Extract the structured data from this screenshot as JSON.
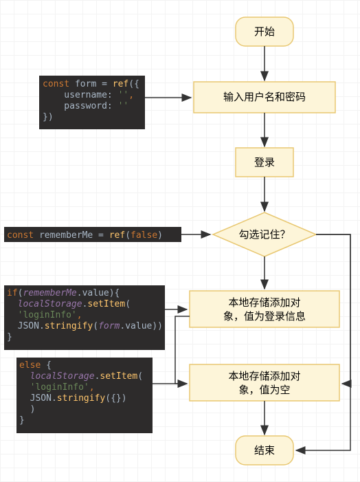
{
  "chart_data": {
    "type": "flowchart",
    "nodes": [
      {
        "id": "start",
        "shape": "rounded",
        "text": "开始"
      },
      {
        "id": "input",
        "shape": "rect",
        "text": "输入用户名和密码"
      },
      {
        "id": "login",
        "shape": "rect",
        "text": "登录"
      },
      {
        "id": "decide",
        "shape": "diamond",
        "text": "勾选记住？"
      },
      {
        "id": "store1",
        "shape": "rect",
        "text": "本地存储添加对象，值为登录信息"
      },
      {
        "id": "store2",
        "shape": "rect",
        "text": "本地存储添加对象，值为空"
      },
      {
        "id": "end",
        "shape": "rounded",
        "text": "结束"
      }
    ],
    "edges": [
      {
        "from": "start",
        "to": "input"
      },
      {
        "from": "input",
        "to": "login"
      },
      {
        "from": "login",
        "to": "decide"
      },
      {
        "from": "decide",
        "to": "store1"
      },
      {
        "from": "store1",
        "to": "store2"
      },
      {
        "from": "store2",
        "to": "end"
      },
      {
        "from": "decide",
        "to": "store2",
        "via": "right"
      },
      {
        "from": "decide",
        "to": "end",
        "via": "right"
      }
    ],
    "annotations": [
      {
        "near": "input",
        "lang": "js",
        "code": "const form = ref({\n    username: '',\n    password: ''\n})"
      },
      {
        "near": "decide",
        "lang": "js",
        "code": "const rememberMe = ref(false)"
      },
      {
        "near": "store1",
        "lang": "js",
        "code": "if(rememberMe.value){\n  localStorage.setItem(\n  'loginInfo',\n  JSON.stringify(form.value))\n}"
      },
      {
        "near": "store2",
        "lang": "js",
        "code": "else {\n  localStorage.setItem(\n  'loginInfo',\n  JSON.stringify({})\n  )\n}"
      }
    ]
  },
  "n": {
    "start": "开始",
    "input": "输入用户名和密码",
    "login": "登录",
    "decide": "勾选记住？",
    "store1a": "本地存储添加对",
    "store1b": "象，值为登录信息",
    "store2a": "本地存储添加对",
    "store2b": "象，值为空",
    "end": "结束"
  },
  "c1": {
    "l1a": "const ",
    "l1b": "form = ",
    "l1c": "ref",
    "l1d": "({",
    "l2a": "    username: ",
    "l2b": "''",
    "l2c": ",",
    "l3a": "    password: ",
    "l3b": "''",
    "l4": "})"
  },
  "c2": {
    "a": "const ",
    "b": "rememberMe = ",
    "c": "ref",
    "d": "(",
    "e": "false",
    "f": ")"
  },
  "c3": {
    "l1a": "if",
    "l1b": "(",
    "l1c": "rememberMe",
    "l1d": ".value){",
    "l2a": "  localStorage",
    "l2b": ".",
    "l2c": "setItem",
    "l2d": "(",
    "l3a": "  'loginInfo'",
    "l3b": ",",
    "l4a": "  JSON.",
    "l4b": "stringify",
    "l4c": "(",
    "l4d": "form",
    "l4e": ".value))",
    "l5": "}"
  },
  "c4": {
    "l1a": "else ",
    "l1b": "{",
    "l2a": "  localStorage",
    "l2b": ".",
    "l2c": "setItem",
    "l2d": "(",
    "l3a": "  'loginInfo'",
    "l3b": ",",
    "l4a": "  JSON.",
    "l4b": "stringify",
    "l4c": "({})",
    "l5": "  )",
    "l6": "}"
  }
}
